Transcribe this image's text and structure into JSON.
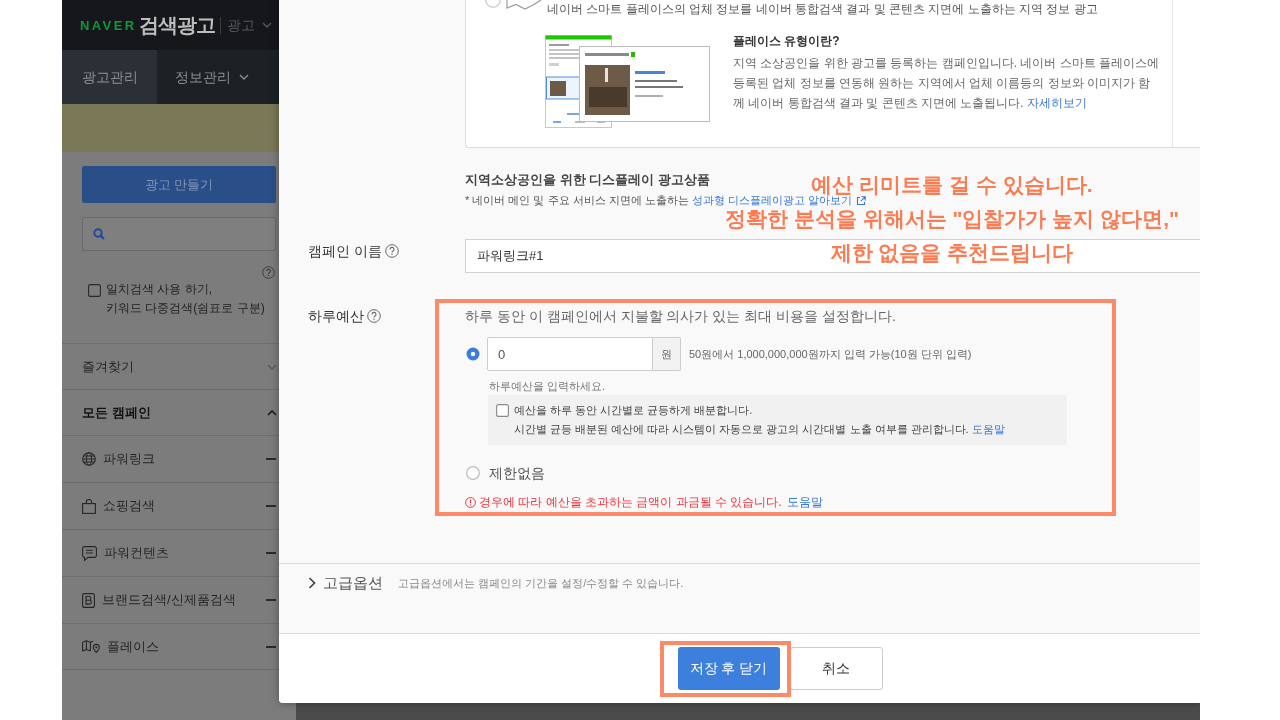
{
  "header": {
    "brand": "NAVER",
    "product": "검색광고",
    "menu_label": "광고"
  },
  "nav_tabs": [
    {
      "label": "광고관리",
      "selected": true,
      "dropdown": false
    },
    {
      "label": "정보관리",
      "selected": false,
      "dropdown": true
    }
  ],
  "sidebar": {
    "create_button": "광고 만들기",
    "exact_match": {
      "label": "일치검색 사용 하기,\n키워드 다중검색(쉼표로 구분)",
      "checked": false
    },
    "sections": [
      {
        "label": "즐겨찾기",
        "expanded": false
      },
      {
        "label": "모든 캠페인",
        "expanded": true
      }
    ],
    "campaign_types": [
      {
        "kind": "globe",
        "label": "파워링크"
      },
      {
        "kind": "bag",
        "label": "쇼핑검색"
      },
      {
        "kind": "chat",
        "label": "파워컨텐츠"
      },
      {
        "kind": "brand",
        "label": "브랜드검색/신제품검색"
      },
      {
        "kind": "map",
        "label": "플레이스"
      }
    ]
  },
  "modal": {
    "place_option": {
      "selected": false,
      "description": "네이버 스마트 플레이스의 업체 정보를 네이버 통합검색 결과 및 콘텐츠 지면에 노출하는 지역 정보 광고",
      "info_title": "플레이스 유형이란?",
      "info_text": "지역 소상공인을 위한 광고를 등록하는 캠페인입니다. 네이버 스마트 플레이스에 등록된 업체 정보를 연동해 원하는 지역에서 업체 이름등의 정보와 이미지가 함께 네이버 통합검색 결과 및 콘텐츠 지면에 노출됩니다.",
      "info_link": "자세히보기"
    },
    "display_ads": {
      "title": "지역소상공인을 위한 디스플레이 광고상품",
      "text": "* 네이버 메인 및 주요 서비스 지면에 노출하는",
      "link": "성과형 디스플레이광고 알아보기"
    },
    "campaign_name": {
      "label": "캠페인 이름",
      "value": "파워링크#1"
    },
    "daily_budget": {
      "label": "하루예산",
      "description": "하루 동안 이 캠페인에서 지불할 의사가 있는 최대 비용을 설정합니다.",
      "options": [
        {
          "kind": "amount",
          "selected": true,
          "value": "0",
          "unit": "원",
          "range_hint": "50원에서 1,000,000,000원까지 입력 가능(10원 단위 입력)",
          "error": "하루예산을 입력하세요.",
          "distribute": {
            "checked": false,
            "label": "예산을 하루 동안 시간별로 균등하게 배분합니다.",
            "note": "시간별 균등 배분된 예산에 따라 시스템이 자동으로 광고의 시간대별 노출 여부를 관리합니다.",
            "link": "도움말"
          }
        },
        {
          "kind": "unlimited",
          "selected": false,
          "label": "제한없음"
        }
      ],
      "warning": {
        "text": "경우에 따라 예산을 초과하는 금액이 과금될 수 있습니다.",
        "link": "도움말"
      }
    },
    "advanced": {
      "label": "고급옵션",
      "description": "고급옵션에서는 캠페인의 기간을 설정/수정할 수 있습니다.",
      "expanded": false
    },
    "buttons": [
      {
        "label": "저장 후 닫기",
        "kind": "primary"
      },
      {
        "label": "취소",
        "kind": "secondary"
      }
    ]
  },
  "annotation": {
    "lines": [
      "예산 리미트를 걸 수 있습니다.",
      "정확한 분석을 위해서는 \"입찰가가 높지 않다면,\"",
      "제한 없음을 추천드립니다"
    ]
  }
}
